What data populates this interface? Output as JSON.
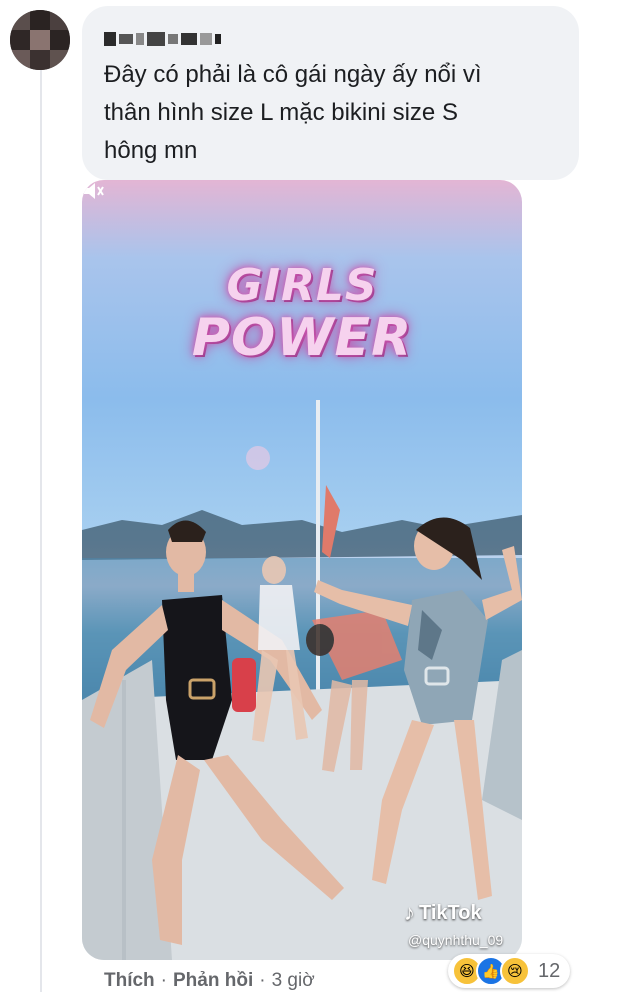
{
  "comment": {
    "author_name_blurred": true,
    "text_line1": "Đây có phải là cô gái ngày ấy nổi vì",
    "text_line2": "thân hình size L mặc bikini size S",
    "text_line3": "hông mn"
  },
  "video": {
    "overlay_line1": "GIRLS",
    "overlay_line2": "POWER",
    "tiktok_label": "TikTok",
    "tiktok_username": "@quynhthu_09"
  },
  "footer": {
    "like_label": "Thích",
    "separator": "·",
    "reply_label": "Phản hồi",
    "time_label": "3 giờ",
    "reaction_icons": [
      "haha-icon",
      "like-icon",
      "sad-icon"
    ],
    "reaction_count": "12"
  }
}
